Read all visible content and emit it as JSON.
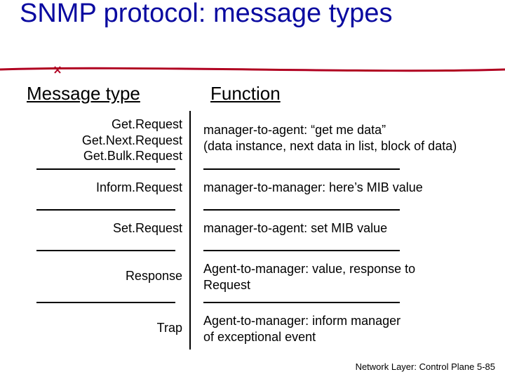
{
  "title": "SNMP protocol: message types",
  "headers": {
    "left": "Message type",
    "right": "Function"
  },
  "rows": [
    {
      "left_lines": [
        "Get.Request",
        "Get.Next.Request",
        "Get.Bulk.Request"
      ],
      "right_lines": [
        "manager-to-agent: “get me data”",
        "(data instance, next data in list, block of data)"
      ]
    },
    {
      "left_lines": [
        "Inform.Request"
      ],
      "right_lines": [
        "manager-to-manager: here’s MIB value"
      ]
    },
    {
      "left_lines": [
        "Set.Request"
      ],
      "right_lines": [
        "manager-to-agent: set MIB value"
      ]
    },
    {
      "left_lines": [
        "Response"
      ],
      "right_lines": [
        "Agent-to-manager: value, response to",
        "Request"
      ]
    },
    {
      "left_lines": [
        "Trap"
      ],
      "right_lines": [
        "Agent-to-manager: inform manager",
        "of exceptional event"
      ]
    }
  ],
  "footer": "Network Layer: Control Plane  5-85"
}
